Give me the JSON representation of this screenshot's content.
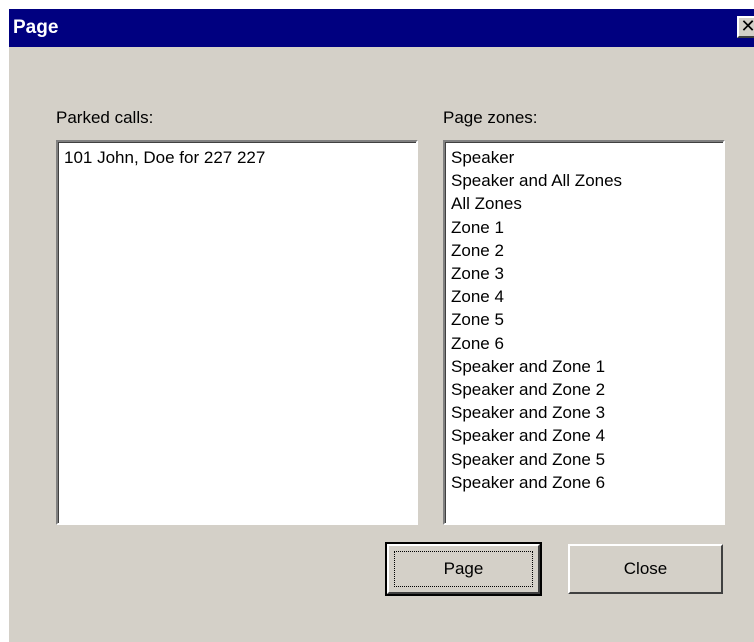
{
  "window": {
    "title": "Page",
    "close_glyph": "✕"
  },
  "parked_calls": {
    "label": "Parked calls:",
    "items": [
      "101 John, Doe  for 227 227"
    ]
  },
  "page_zones": {
    "label": "Page zones:",
    "items": [
      "Speaker",
      "Speaker and All Zones",
      "All Zones",
      "Zone 1",
      "Zone 2",
      "Zone 3",
      "Zone 4",
      "Zone 5",
      "Zone 6",
      "Speaker and Zone 1",
      "Speaker and Zone 2",
      "Speaker and Zone 3",
      "Speaker and Zone 4",
      "Speaker and Zone 5",
      "Speaker and Zone 6"
    ]
  },
  "buttons": {
    "page_label": "Page",
    "close_label": "Close"
  },
  "colors": {
    "titlebar": "#000080",
    "face": "#d4d0c8",
    "list_background": "#ffffff"
  }
}
